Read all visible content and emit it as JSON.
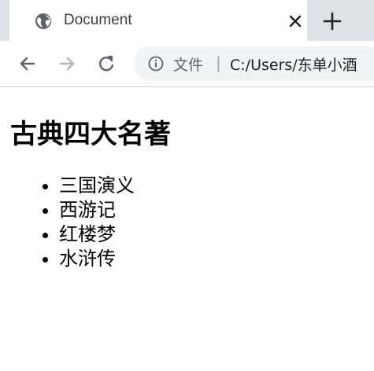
{
  "browser": {
    "tab": {
      "title": "Document",
      "favicon_icon": "globe-icon",
      "close_icon": "close-icon"
    },
    "new_tab_icon": "plus-icon",
    "toolbar": {
      "back_icon": "back-arrow-icon",
      "forward_icon": "forward-arrow-icon",
      "reload_icon": "reload-icon",
      "info_icon": "info-icon",
      "security_label": "文件",
      "separator": "|",
      "url": "C:/Users/东单小酒"
    }
  },
  "page": {
    "heading": "古典四大名著",
    "items": [
      "三国演义",
      "西游记",
      "红楼梦",
      "水浒传"
    ]
  },
  "colors": {
    "tabstrip": "#dee1e6",
    "omnibox": "#f1f3f4",
    "icon": "#5f6368"
  }
}
